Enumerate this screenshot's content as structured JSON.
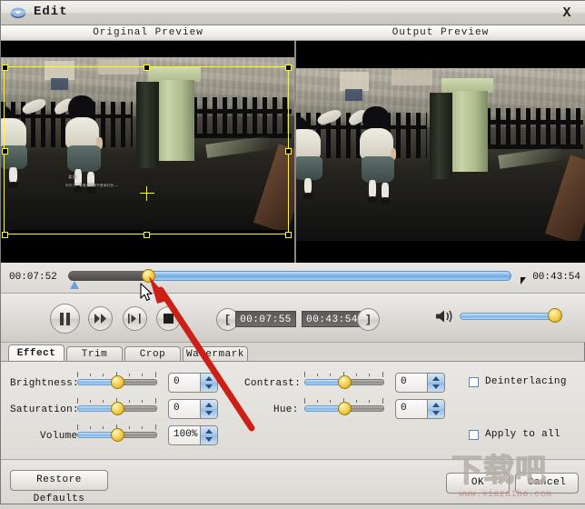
{
  "window": {
    "title": "Edit",
    "icon": "disc-icon",
    "close_label": "X"
  },
  "preview": {
    "left_header": "Original Preview",
    "right_header": "Output Preview",
    "subtitle_name": "姜园",
    "subtitle_line": "你们了！看着我家是不是我们的——",
    "crop_overlay": "yellow-crop-rectangle"
  },
  "timeline": {
    "current_time": "00:07:52",
    "total_time": "00:43:54",
    "played_percent": 18,
    "knob": "timeline-knob"
  },
  "transport": {
    "buttons": [
      {
        "name": "pause-button",
        "glyph": "pause"
      },
      {
        "name": "fast-forward-button",
        "glyph": "forward"
      },
      {
        "name": "next-frame-button",
        "glyph": "frame"
      },
      {
        "name": "stop-button",
        "glyph": "stop"
      }
    ],
    "mark_in_label": "[",
    "mark_out_label": "]",
    "start_time": "00:07:55",
    "end_time": "00:43:54",
    "volume_percent": 100,
    "volume_icon": "speaker-icon"
  },
  "tabs": [
    {
      "label": "Effect",
      "active": true
    },
    {
      "label": "Trim",
      "active": false
    },
    {
      "label": "Crop",
      "active": false
    },
    {
      "label": "Watermark",
      "active": false
    }
  ],
  "effect_panel": {
    "controls": [
      {
        "label": "Brightness:",
        "value": "0",
        "slider_percent": 50
      },
      {
        "label": "Saturation:",
        "value": "0",
        "slider_percent": 50
      },
      {
        "label": "Volume:",
        "value": "100%",
        "slider_percent": 50
      },
      {
        "label": "Contrast:",
        "value": "0",
        "slider_percent": 50
      },
      {
        "label": "Hue:",
        "value": "0",
        "slider_percent": 50
      }
    ],
    "checkboxes": [
      {
        "label": "Deinterlacing",
        "checked": false
      },
      {
        "label": "Apply to all",
        "checked": false
      }
    ]
  },
  "footer": {
    "restore_defaults": "Restore Defaults",
    "ok": "OK",
    "cancel": "Cancel"
  },
  "watermark": {
    "cn_text": "下载吧",
    "url_text": "www.xiazaiba.com"
  },
  "colors": {
    "accent_blue": "#7bb3e6",
    "knob_yellow": "#f0c63a",
    "crop_yellow": "#ffff00",
    "arrow_red": "#cc1f16",
    "panel_bg": "#e3e0db"
  }
}
